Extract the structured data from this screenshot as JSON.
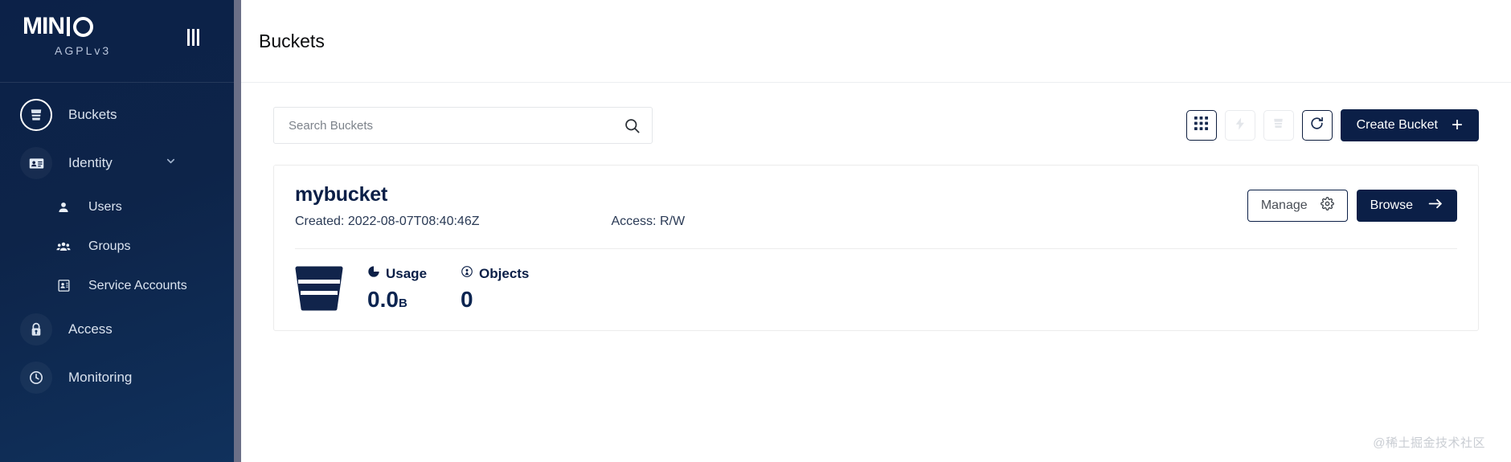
{
  "sidebar": {
    "logo": {
      "text_min": "MIN",
      "text_o": "O",
      "sublabel": "AGPLv3"
    },
    "collapse_label": "collapse-menu",
    "items": [
      {
        "label": "Buckets",
        "icon": "bucket-icon",
        "state": "active",
        "type": "item"
      },
      {
        "label": "Identity",
        "icon": "identity-card-icon",
        "state": "expanded",
        "type": "group",
        "chevron": "chevron-down-icon"
      },
      {
        "label": "Users",
        "icon": "user-icon",
        "type": "subitem"
      },
      {
        "label": "Groups",
        "icon": "group-icon",
        "type": "subitem"
      },
      {
        "label": "Service Accounts",
        "icon": "service-account-icon",
        "type": "subitem"
      },
      {
        "label": "Access",
        "icon": "lock-icon",
        "type": "item"
      },
      {
        "label": "Monitoring",
        "icon": "monitoring-icon",
        "type": "item"
      }
    ]
  },
  "header": {
    "title": "Buckets"
  },
  "toolbar": {
    "search": {
      "placeholder": "Search Buckets",
      "value": ""
    },
    "search_icon": "search-icon",
    "buttons": [
      {
        "name": "grid-view-button",
        "icon": "grid-icon",
        "state": "active"
      },
      {
        "name": "lightning-button",
        "icon": "lightning-icon",
        "state": "disabled"
      },
      {
        "name": "delete-bucket-button",
        "icon": "bucket-delete-icon",
        "state": "disabled"
      },
      {
        "name": "refresh-button",
        "icon": "refresh-icon",
        "state": "enabled"
      }
    ],
    "create_label": "Create Bucket",
    "create_plus": "+"
  },
  "buckets": [
    {
      "name": "mybucket",
      "created": "Created: 2022-08-07T08:40:46Z",
      "access": "Access: R/W",
      "usage_label": "Usage",
      "usage_value": "0.0",
      "usage_unit": "B",
      "objects_label": "Objects",
      "objects_value": "0",
      "manage_label": "Manage",
      "browse_label": "Browse"
    }
  ],
  "watermark": "@稀土掘金技术社区",
  "colors": {
    "sidebar_bg": "#0c2148",
    "accent_dark": "#0b1f47",
    "text_muted": "#7d838b",
    "card_border": "#ececec"
  }
}
